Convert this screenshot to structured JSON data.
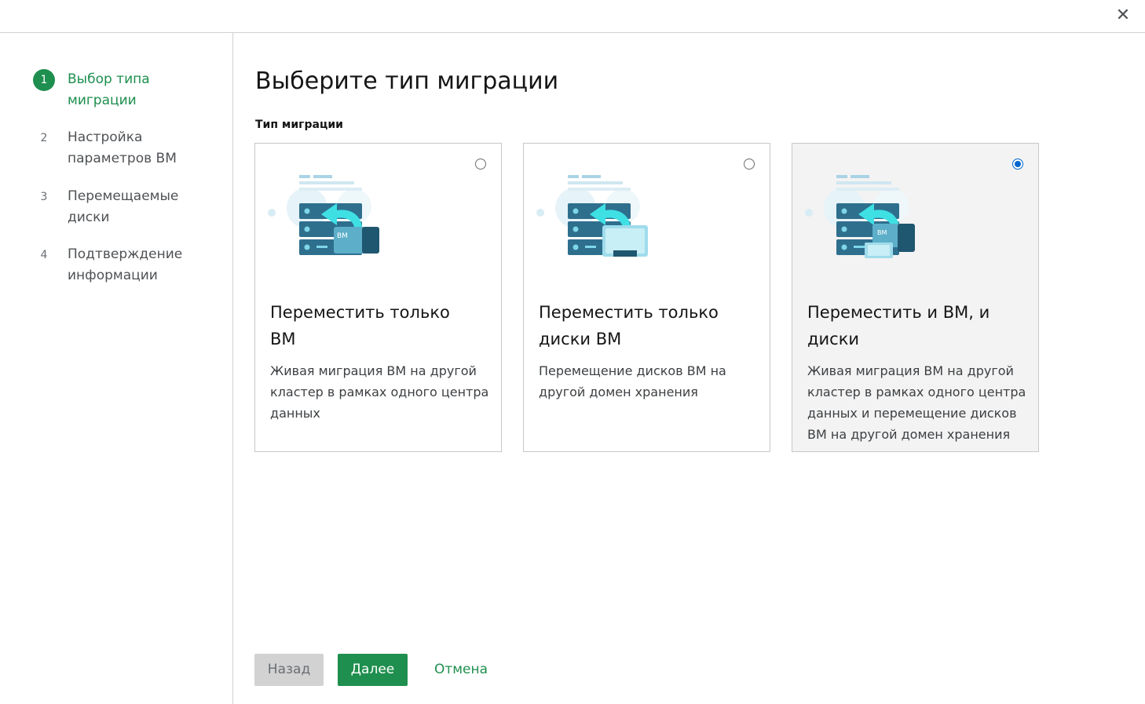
{
  "header": {
    "close_icon": "✕"
  },
  "steps": [
    {
      "num": "1",
      "label": "Выбор типа миграции",
      "active": true
    },
    {
      "num": "2",
      "label": "Настройка параметров ВМ",
      "active": false
    },
    {
      "num": "3",
      "label": "Перемещаемые диски",
      "active": false
    },
    {
      "num": "4",
      "label": "Подтверждение информации",
      "active": false
    }
  ],
  "main": {
    "title": "Выберите тип миграции",
    "section_label": "Тип миграции",
    "cards": [
      {
        "title": "Переместить только ВМ",
        "description": "Живая миграция ВМ на другой кластер в рамках одного центра данных",
        "selected": false,
        "badge": "ВМ",
        "illustration": "server-vm-migrate-icon"
      },
      {
        "title": "Переместить только диски ВМ",
        "description": "Перемещение дисков ВМ на другой домен хранения",
        "selected": false,
        "badge": "",
        "illustration": "server-disk-migrate-icon"
      },
      {
        "title": "Переместить и ВМ, и диски",
        "description": "Живая миграция ВМ на другой кластер в рамках одного центра данных и перемещение дисков ВМ на другой домен хранения",
        "selected": true,
        "badge": "ВМ",
        "illustration": "server-vm-disk-migrate-icon"
      }
    ]
  },
  "footer": {
    "back_label": "Назад",
    "next_label": "Далее",
    "cancel_label": "Отмена"
  },
  "colors": {
    "accent": "#1e8f4e",
    "radio_selected": "#0066cc",
    "illustration_primary": "#2e6f8e",
    "illustration_arrow": "#3ee0e4"
  }
}
